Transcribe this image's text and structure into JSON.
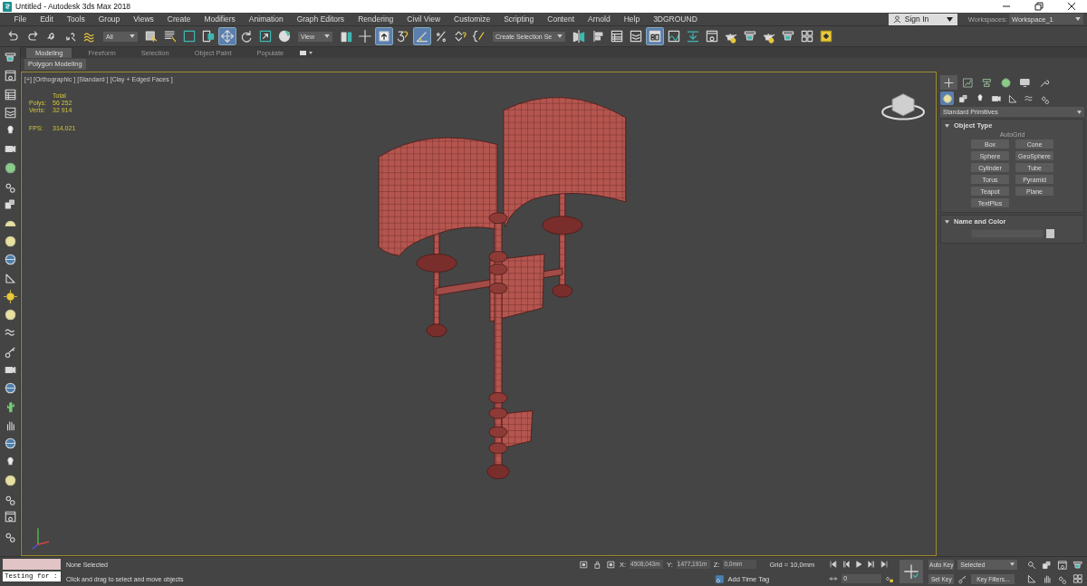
{
  "window": {
    "title": "Untitled - Autodesk 3ds Max 2018"
  },
  "menu_bar": [
    "File",
    "Edit",
    "Tools",
    "Group",
    "Views",
    "Create",
    "Modifiers",
    "Animation",
    "Graph Editors",
    "Rendering",
    "Civil View",
    "Customize",
    "Scripting",
    "Content",
    "Arnold",
    "Help",
    "3DGROUND"
  ],
  "account": {
    "sign_in": "Sign In",
    "workspaces_label": "Workspaces:",
    "workspace": "Workspace_1"
  },
  "main_toolbar": [
    {
      "kind": "tool",
      "active": false
    },
    {
      "kind": "tool",
      "active": false
    },
    {
      "kind": "tool",
      "active": false
    },
    {
      "kind": "tool",
      "active": false
    },
    {
      "kind": "tool",
      "active": false
    },
    {
      "kind": "dropdown",
      "value": "All"
    },
    {
      "kind": "tool",
      "active": false
    },
    {
      "kind": "tool",
      "active": false
    },
    {
      "kind": "tool",
      "active": false
    },
    {
      "kind": "tool",
      "active": false
    },
    {
      "kind": "tool",
      "active": true
    },
    {
      "kind": "tool",
      "active": false
    },
    {
      "kind": "tool",
      "active": false
    },
    {
      "kind": "tool",
      "active": false
    },
    {
      "kind": "dropdown",
      "value": "View"
    },
    {
      "kind": "tool",
      "active": false
    },
    {
      "kind": "tool",
      "active": false
    },
    {
      "kind": "tool",
      "active": true
    },
    {
      "kind": "tool",
      "active": false
    },
    {
      "kind": "tool",
      "active": true
    },
    {
      "kind": "tool",
      "active": false
    },
    {
      "kind": "tool",
      "active": false
    },
    {
      "kind": "tool",
      "active": false
    },
    {
      "kind": "dropdown",
      "value": "Create Selection Se"
    },
    {
      "kind": "tool",
      "active": false
    },
    {
      "kind": "tool",
      "active": false
    },
    {
      "kind": "tool",
      "active": false
    },
    {
      "kind": "tool",
      "active": false
    },
    {
      "kind": "tool",
      "active": true
    },
    {
      "kind": "tool",
      "active": false
    },
    {
      "kind": "tool",
      "active": false
    },
    {
      "kind": "tool",
      "active": false
    },
    {
      "kind": "tool",
      "active": false
    },
    {
      "kind": "tool",
      "active": false
    },
    {
      "kind": "tool",
      "active": false
    },
    {
      "kind": "tool",
      "active": false
    },
    {
      "kind": "tool",
      "active": false
    },
    {
      "kind": "tool",
      "active": false
    }
  ],
  "ribbon": {
    "tabs": [
      {
        "label": "Modeling",
        "selected": true
      },
      {
        "label": "Freeform",
        "selected": false
      },
      {
        "label": "Selection",
        "selected": false
      },
      {
        "label": "Object Paint",
        "selected": false
      },
      {
        "label": "Populate",
        "selected": false
      }
    ],
    "panel": "Polygon Modeling"
  },
  "viewport": {
    "labels": [
      "[+]",
      "[Orthographic ]",
      "[Standard ]",
      "[Clay + Edged Faces ]"
    ],
    "stats": {
      "header": "Total",
      "rows": [
        {
          "label": "Polys:",
          "value": "56 252"
        },
        {
          "label": "Verts:",
          "value": "32 914"
        },
        {
          "label": "FPS:",
          "value": "314,021"
        }
      ]
    }
  },
  "command_panel": {
    "tabs": [
      {
        "selected": true
      },
      {
        "selected": false
      },
      {
        "selected": false
      },
      {
        "selected": false
      },
      {
        "selected": false
      },
      {
        "selected": false
      }
    ],
    "categories": [
      {
        "selected": true
      },
      {
        "selected": false
      },
      {
        "selected": false
      },
      {
        "selected": false
      },
      {
        "selected": false
      },
      {
        "selected": false
      },
      {
        "selected": false
      }
    ],
    "category": "Standard Primitives",
    "object_type": {
      "title": "Object Type",
      "expanded": true,
      "autogrid": {
        "label": "AutoGrid",
        "disabled": true
      },
      "buttons": [
        "Box",
        "Cone",
        "Sphere",
        "GeoSphere",
        "Cylinder",
        "Tube",
        "Torus",
        "Pyramid",
        "Teapot",
        "Plane",
        "TextPlus"
      ]
    },
    "name_and_color": {
      "title": "Name and Color",
      "expanded": true
    }
  },
  "status_bar": {
    "listener": "Testing for :",
    "selection": "None Selected",
    "prompt": "Click and drag to select and move objects",
    "coords": [
      {
        "label": "X:",
        "value": "4508,043m"
      },
      {
        "label": "Y:",
        "value": "1477,191m"
      },
      {
        "label": "Z:",
        "value": "0,0mm"
      }
    ],
    "grid": "Grid = 10,0mm",
    "add_time_tag": "Add Time Tag",
    "frame": "0",
    "auto_key": "Auto Key",
    "key_mode": "Selected",
    "set_key": "Set Key",
    "key_filters": "Key Filters..."
  }
}
